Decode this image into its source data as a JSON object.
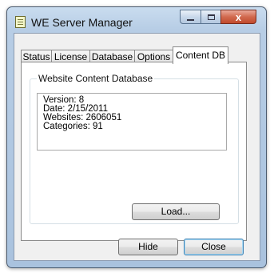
{
  "window": {
    "title": "WE Server Manager",
    "icon": "notepad-icon",
    "controls": {
      "minimize": "minimize-icon",
      "maximize": "maximize-icon",
      "close_glyph": "x"
    }
  },
  "tabs": [
    {
      "label": "Status",
      "active": false
    },
    {
      "label": "License",
      "active": false
    },
    {
      "label": "Database",
      "active": false
    },
    {
      "label": "Options",
      "active": false
    },
    {
      "label": "Content DB",
      "active": true
    }
  ],
  "content_db": {
    "group_label": "Website Content Database",
    "info_lines": [
      "Version: 8",
      "Date: 2/15/2011",
      "Websites: 2606051",
      "Categories: 91"
    ],
    "load_label": "Load..."
  },
  "footer": {
    "hide_label": "Hide",
    "close_label": "Close"
  }
}
